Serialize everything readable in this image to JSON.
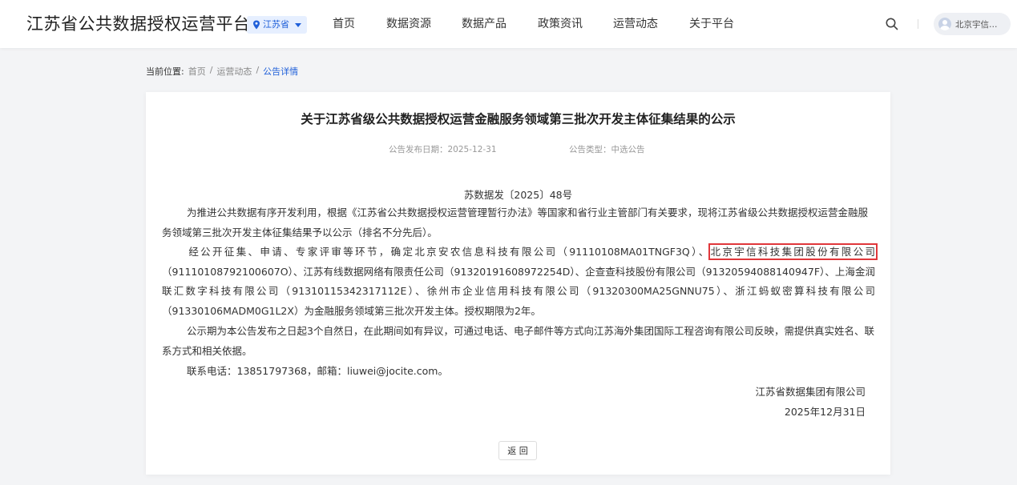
{
  "header": {
    "site_title": "江苏省公共数据授权运营平台",
    "region_label": "江苏省",
    "nav": [
      "首页",
      "数据资源",
      "数据产品",
      "政策资讯",
      "运营动态",
      "关于平台"
    ],
    "user_name": "北京宇信…"
  },
  "breadcrumb": {
    "lead": "当前位置:",
    "items": [
      "首页",
      "运营动态",
      "公告详情"
    ],
    "separator": "/"
  },
  "notice": {
    "title": "关于江苏省级公共数据授权运营金融服务领域第三批次开发主体征集结果的公示",
    "publish_date": "公告发布日期：2025-12-31",
    "notice_type": "公告类型：中选公告",
    "doc_number": "苏数据发〔2025〕48号",
    "para1": "为推进公共数据有序开发利用，根据《江苏省公共数据授权运营管理暂行办法》等国家和省行业主管部门有关要求，现将江苏省级公共数据授权运营金融服务领域第三批次开发主体征集结果予以公示（排名不分先后）。",
    "para2_before": "经公开征集、申请、专家评审等环节，确定北京安农信息科技有限公司（91110108MA01TNGF3Q）、",
    "para2_highlight": "北京宇信科技集团股份有限公司",
    "para2_after": "（91110108792100607O）、江苏有线数据网络有限责任公司（91320191608972254D）、企查查科技股份有限公司（91320594088140947F）、上海金润联汇数字科技有限公司（91310115342317112E）、徐州市企业信用科技有限公司（91320300MA25GNNU75）、浙江蚂蚁密算科技有限公司（91330106MADM0G1L2X）为金融服务领域第三批次开发主体。授权期限为2年。",
    "para3": "公示期为本公告发布之日起3个自然日，在此期间如有异议，可通过电话、电子邮件等方式向江苏海外集团国际工程咨询有限公司反映，需提供真实姓名、联系方式和相关依据。",
    "para4": "联系电话：13851797368，邮箱：liuwei@jocite.com。",
    "signer": "江苏省数据集团有限公司",
    "sign_date": "2025年12月31日",
    "back_label": "返 回"
  },
  "colors": {
    "accent": "#1f5fd9",
    "highlight_border": "#e0373b",
    "region_bg": "#e6efff"
  },
  "icons": {
    "region": "location-pin-icon",
    "region_caret": "caret-down-icon",
    "search": "search-icon",
    "avatar": "user-avatar-icon"
  }
}
